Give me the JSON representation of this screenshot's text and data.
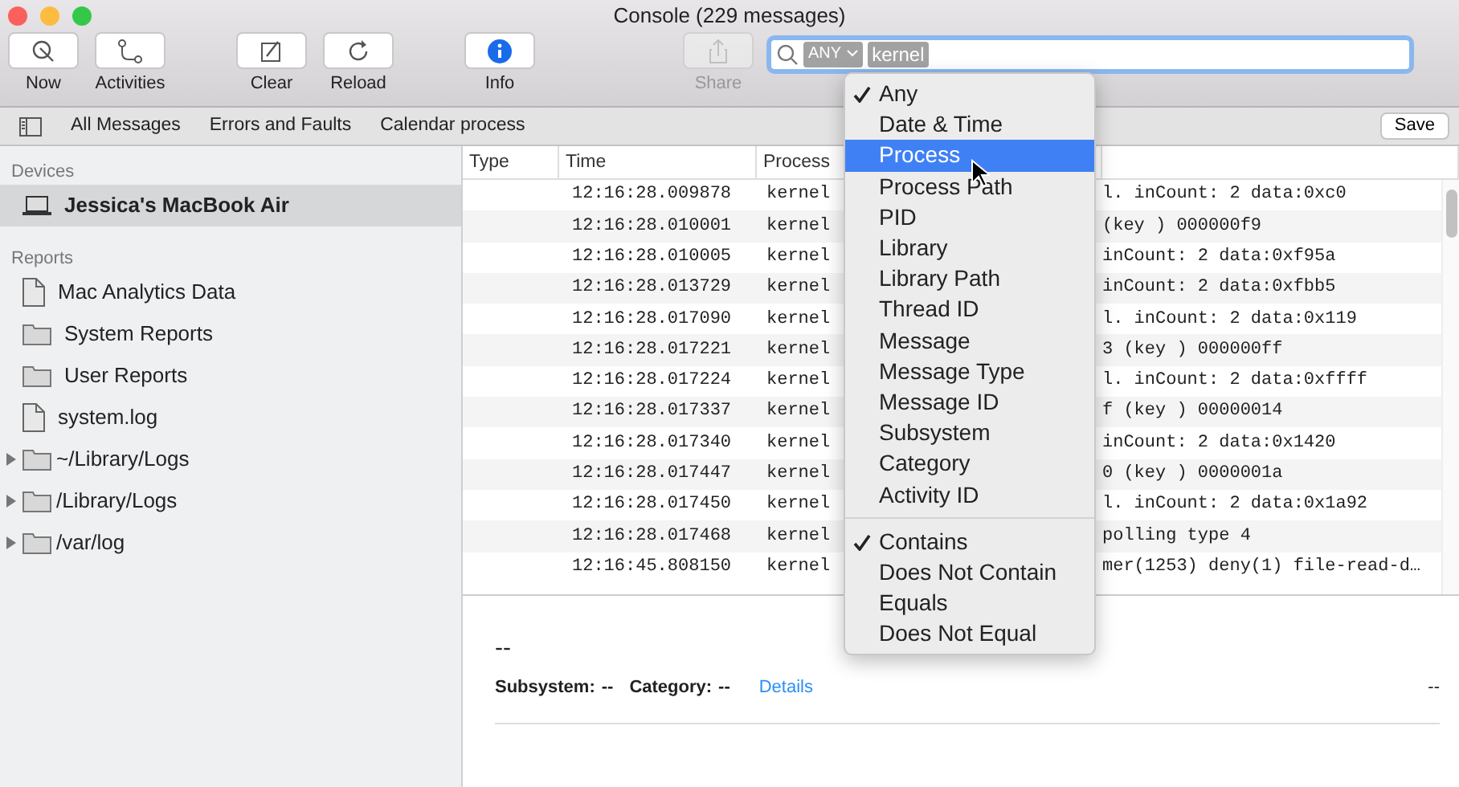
{
  "window": {
    "title": "Console (229 messages)"
  },
  "toolbar": [
    {
      "label": "Now",
      "disabled": false
    },
    {
      "label": "Activities",
      "disabled": false
    },
    {
      "label": "Clear",
      "disabled": false
    },
    {
      "label": "Reload",
      "disabled": false
    },
    {
      "label": "Info",
      "disabled": false
    },
    {
      "label": "Share",
      "disabled": true
    }
  ],
  "search": {
    "tokens": [
      {
        "text": "ANY",
        "kind": "menu"
      },
      {
        "text": "kernel",
        "kind": "value"
      }
    ]
  },
  "filter_bar": {
    "items": [
      "All Messages",
      "Errors and Faults",
      "Calendar process"
    ],
    "save": "Save"
  },
  "sidebar": {
    "sections": [
      {
        "title": "Devices",
        "items": [
          {
            "label": "Jessica's MacBook Air",
            "kind": "laptop",
            "selected": true
          }
        ]
      },
      {
        "title": "Reports",
        "items": [
          {
            "label": "Mac Analytics Data",
            "kind": "file",
            "selected": false
          },
          {
            "label": "System Reports",
            "kind": "folder",
            "selected": false
          },
          {
            "label": "User Reports",
            "kind": "folder",
            "selected": false
          },
          {
            "label": "system.log",
            "kind": "file",
            "selected": false
          },
          {
            "label": "~/Library/Logs",
            "kind": "folder",
            "selected": false,
            "expanded": false
          },
          {
            "label": "/Library/Logs",
            "kind": "folder",
            "selected": false,
            "expanded": false
          },
          {
            "label": "/var/log",
            "kind": "folder",
            "selected": false,
            "expanded": false
          }
        ]
      }
    ]
  },
  "table": {
    "columns": [
      "Type",
      "Time",
      "Process"
    ],
    "rows": [
      {
        "time": "12:16:28.009878",
        "process": "kernel",
        "message": "l. inCount: 2 data:0xc0"
      },
      {
        "time": "12:16:28.010001",
        "process": "kernel",
        "message": "(key     ) 000000f9"
      },
      {
        "time": "12:16:28.010005",
        "process": "kernel",
        "message": "inCount: 2 data:0xf95a"
      },
      {
        "time": "12:16:28.013729",
        "process": "kernel",
        "message": "inCount: 2 data:0xfbb5"
      },
      {
        "time": "12:16:28.017090",
        "process": "kernel",
        "message": "l. inCount: 2 data:0x119"
      },
      {
        "time": "12:16:28.017221",
        "process": "kernel",
        "message": "3 (key     ) 000000ff"
      },
      {
        "time": "12:16:28.017224",
        "process": "kernel",
        "message": "l. inCount: 2 data:0xffff"
      },
      {
        "time": "12:16:28.017337",
        "process": "kernel",
        "message": "f (key     ) 00000014"
      },
      {
        "time": "12:16:28.017340",
        "process": "kernel",
        "message": "inCount: 2 data:0x1420"
      },
      {
        "time": "12:16:28.017447",
        "process": "kernel",
        "message": "0 (key     ) 0000001a"
      },
      {
        "time": "12:16:28.017450",
        "process": "kernel",
        "message": "l. inCount: 2 data:0x1a92"
      },
      {
        "time": "12:16:28.017468",
        "process": "kernel",
        "message": "polling type 4"
      },
      {
        "time": "12:16:45.808150",
        "process": "kernel",
        "message": "mer(1253) deny(1) file-read-d…"
      }
    ]
  },
  "detail": {
    "headline": "--",
    "fields": [
      {
        "label": "Subsystem:",
        "value": "--"
      },
      {
        "label": "Category:",
        "value": "--"
      }
    ],
    "link": "Details",
    "right": "--"
  },
  "menu": {
    "groups": [
      [
        {
          "label": "Any",
          "checked": true,
          "selected": false
        },
        {
          "label": "Date & Time",
          "checked": false,
          "selected": false
        },
        {
          "label": "Process",
          "checked": false,
          "selected": true
        },
        {
          "label": "Process Path",
          "checked": false,
          "selected": false
        },
        {
          "label": "PID",
          "checked": false,
          "selected": false
        },
        {
          "label": "Library",
          "checked": false,
          "selected": false
        },
        {
          "label": "Library Path",
          "checked": false,
          "selected": false
        },
        {
          "label": "Thread ID",
          "checked": false,
          "selected": false
        },
        {
          "label": "Message",
          "checked": false,
          "selected": false
        },
        {
          "label": "Message Type",
          "checked": false,
          "selected": false
        },
        {
          "label": "Message ID",
          "checked": false,
          "selected": false
        },
        {
          "label": "Subsystem",
          "checked": false,
          "selected": false
        },
        {
          "label": "Category",
          "checked": false,
          "selected": false
        },
        {
          "label": "Activity ID",
          "checked": false,
          "selected": false
        }
      ],
      [
        {
          "label": "Contains",
          "checked": true,
          "selected": false
        },
        {
          "label": "Does Not Contain",
          "checked": false,
          "selected": false
        },
        {
          "label": "Equals",
          "checked": false,
          "selected": false
        },
        {
          "label": "Does Not Equal",
          "checked": false,
          "selected": false
        }
      ]
    ]
  }
}
